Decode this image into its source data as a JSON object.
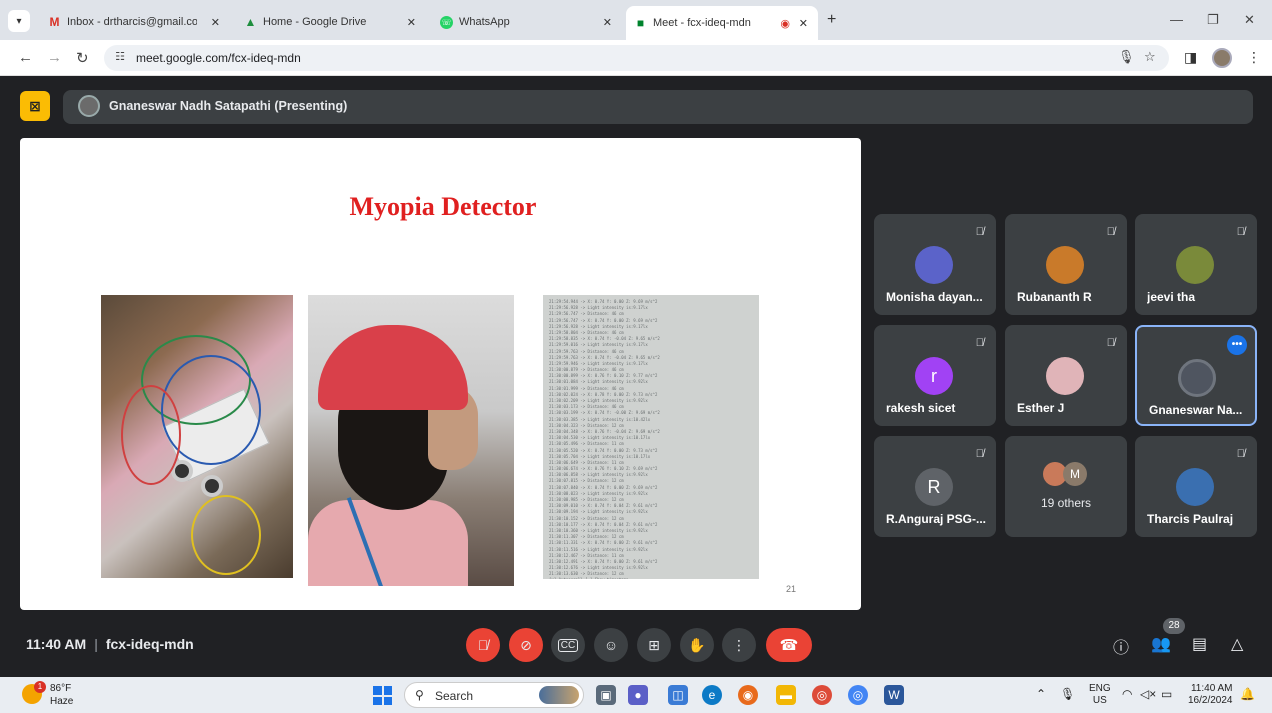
{
  "browser": {
    "tabs": [
      {
        "title": "Inbox - drtharcis@gmail.com -",
        "icon": "gmail-icon"
      },
      {
        "title": "Home - Google Drive",
        "icon": "drive-icon"
      },
      {
        "title": "WhatsApp",
        "icon": "whatsapp-icon"
      },
      {
        "title": "Meet - fcx-ideq-mdn",
        "icon": "meet-icon",
        "active": true
      }
    ],
    "url": "meet.google.com/fcx-ideq-mdn"
  },
  "meet": {
    "presenter_label": "Gnaneswar Nadh Satapathi (Presenting)",
    "slide": {
      "title": "Myopia Detector",
      "page_number": "21",
      "serial_lines": [
        "21:29:54.944 -> X: 0.74  Y: 0.00  Z: 9.69  m/s^2",
        "21:29:56.928 -> Light intensity is:9.17lx",
        "21:29:56.747 -> Distance: 46 cm",
        "21:29:56.747 -> X: 0.74  Y: 0.00  Z: 9.69  m/s^2",
        "21:29:56.928 -> Light intensity is:9.17lx",
        "21:29:58.804 -> Distance: 46 cm",
        "21:29:58.835 -> X: 0.74  Y: -0.04  Z: 9.65  m/s^2",
        "21:29:59.016 -> Light intensity is:9.17lx",
        "21:29:59.763 -> Distance: 46 cm",
        "21:29:59.763 -> X: 0.74  Y: -0.04  Z: 9.65  m/s^2",
        "21:29:59.946 -> Light intensity is:9.17lx",
        "21:30:00.879 -> Distance: 46 cm",
        "21:30:00.899 -> X: 0.76  Y: 0.10  Z: 9.77  m/s^2",
        "21:30:01.084 -> Light intensity is:9.92lx",
        "21:30:01.999 -> Distance: 46 cm",
        "21:30:02.024 -> X: 0.78  Y: 0.00  Z: 9.73  m/s^2",
        "21:30:02.209 -> Light intensity is:9.92lx",
        "21:30:03.173 -> Distance: 46 cm",
        "21:30:03.199 -> X: 0.74  Y: -0.00  Z: 9.69  m/s^2",
        "21:30:03.385 -> Light intensity is:10.42lx",
        "21:30:04.323 -> Distance: 12 cm",
        "21:30:04.348 -> X: 0.76  Y: -0.04  Z: 9.69  m/s^2",
        "21:30:04.530 -> Light intensity is:10.17lx",
        "21:30:05.496 -> Distance: 11 cm",
        "21:30:05.520 -> X: 0.74  Y: 0.00  Z: 9.73  m/s^2",
        "21:30:05.704 -> Light intensity is:10.17lx",
        "21:30:06.649 -> Distance: 11 cm",
        "21:30:06.674 -> X: 0.76  Y: 0.10  Z: 9.69  m/s^2",
        "21:30:06.858 -> Light intensity is:9.92lx",
        "21:30:07.815 -> Distance: 12 cm",
        "21:30:07.840 -> X: 0.74  Y: 0.00  Z: 9.69  m/s^2",
        "21:30:08.023 -> Light intensity is:9.92lx",
        "21:30:08.985 -> Distance: 12 cm",
        "21:30:09.010 -> X: 0.74  Y: 0.04  Z: 9.61  m/s^2",
        "21:30:09.194 -> Light intensity is:9.92lx",
        "21:30:10.152 -> Distance: 12 cm",
        "21:30:10.177 -> X: 0.74  Y: 0.04  Z: 9.61  m/s^2",
        "21:30:10.360 -> Light intensity is:9.92lx",
        "21:30:11.307 -> Distance: 12 cm",
        "21:30:11.331 -> X: 0.74  Y: 0.00  Z: 9.61  m/s^2",
        "21:30:11.516 -> Light intensity is:9.92lx",
        "21:30:12.467 -> Distance: 11 cm",
        "21:30:12.491 -> X: 0.74  Y: 0.00  Z: 9.61  m/s^2",
        "21:30:12.676 -> Light intensity is:9.92lx",
        "21:30:13.630 -> Distance: 12 cm",
        "[x] Autoscroll  [ ] Show timestamp"
      ]
    },
    "participants": [
      {
        "name": "Monisha dayan...",
        "avatar_color": "#5b63c9",
        "muted": true
      },
      {
        "name": "Rubananth R",
        "avatar_color": "#c97a2a",
        "muted": true
      },
      {
        "name": "jeevi tha",
        "avatar_color": "#7a8a3a",
        "muted": true
      },
      {
        "name": "rakesh sicet",
        "avatar_letter": "r",
        "avatar_color": "#a142f4",
        "muted": true
      },
      {
        "name": "Esther J",
        "avatar_color": "#e0b4b8",
        "muted": true
      },
      {
        "name": "Gnaneswar Na...",
        "avatar_color": "#4f5560",
        "speaking": true
      },
      {
        "name": "R.Anguraj PSG-...",
        "avatar_letter": "R",
        "avatar_color": "#5f6368",
        "muted": true
      },
      {
        "others_label": "19 others",
        "avatar_letter": "M"
      },
      {
        "name": "Tharcis Paulraj",
        "avatar_color": "#3a6fb0",
        "muted": true
      }
    ],
    "meeting_time": "11:40 AM",
    "meeting_code": "fcx-ideq-mdn",
    "people_count": "28"
  },
  "taskbar": {
    "weather_badge": "1",
    "weather_temp": "86°F",
    "weather_desc": "Haze",
    "search_label": "Search",
    "lang_line1": "ENG",
    "lang_line2": "US",
    "clock_time": "11:40 AM",
    "clock_date": "16/2/2024"
  },
  "colors": {
    "meet_bg": "#202124",
    "tile_bg": "#3c4043",
    "danger": "#ea4335",
    "speaking_border": "#8ab4f8",
    "present_yellow": "#fbbc04"
  }
}
